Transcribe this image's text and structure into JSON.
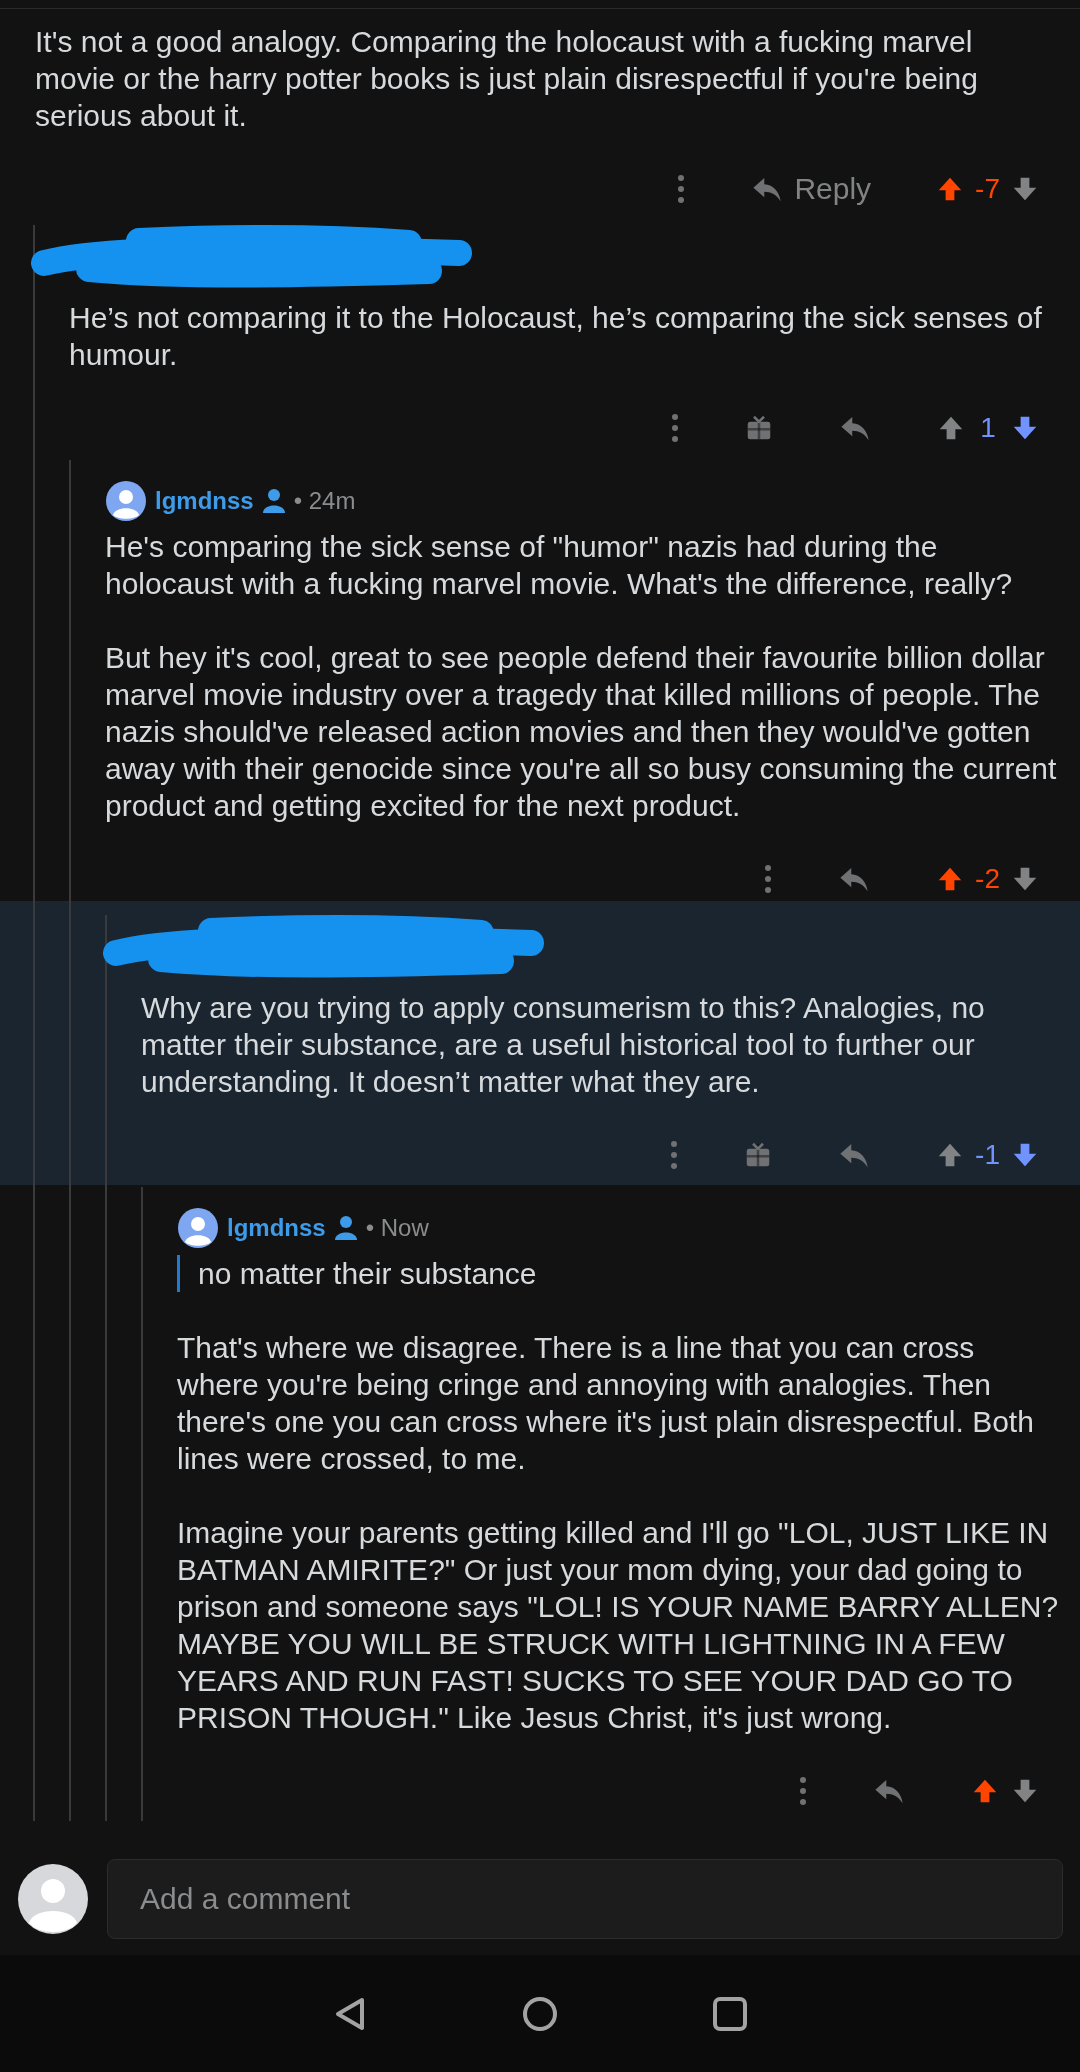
{
  "comments": [
    {
      "author_redacted": false,
      "highlighted": false,
      "body": [
        {
          "kind": "paragraph",
          "text": "It's not a good analogy. Comparing the holocaust with a fucking marvel movie or the harry potter books is just plain disrespectful if you're being serious about it."
        }
      ],
      "gift": false,
      "reply_label": "Reply",
      "upvoted": true,
      "downvoted": false,
      "score": "-7",
      "children": [
        {
          "author_redacted": true,
          "highlighted": false,
          "body": [
            {
              "kind": "paragraph",
              "text": "He’s not comparing it to the Holocaust, he’s comparing the sick senses of humour."
            }
          ],
          "gift": true,
          "upvoted": false,
          "downvoted": true,
          "score": "1",
          "children": [
            {
              "author_redacted": false,
              "highlighted": false,
              "author": {
                "name": "lgmdnss",
                "time": "• 24m"
              },
              "body": [
                {
                  "kind": "paragraph",
                  "text": "He's comparing the sick sense of \"humor\" nazis had during the holocaust with a fucking marvel movie. What's the difference, really?"
                },
                {
                  "kind": "paragraph",
                  "text": "But hey it's cool, great to see people defend their favourite billion dollar marvel movie industry over a tragedy that killed millions of people. The nazis should've released action movies and then they would've gotten away with their genocide since you're all so busy consuming the current product and getting excited for the next product."
                }
              ],
              "gift": false,
              "upvoted": true,
              "downvoted": false,
              "score": "-2",
              "children": [
                {
                  "author_redacted": true,
                  "highlighted": true,
                  "body": [
                    {
                      "kind": "paragraph",
                      "text": "Why are you trying to apply consumerism to this? Analogies, no matter their substance, are a useful historical tool to further our understanding. It doesn’t matter what they are."
                    }
                  ],
                  "gift": true,
                  "upvoted": false,
                  "downvoted": true,
                  "score": "-1",
                  "children": [
                    {
                      "author_redacted": false,
                      "highlighted": false,
                      "author": {
                        "name": "lgmdnss",
                        "time": "• Now"
                      },
                      "body": [
                        {
                          "kind": "quote",
                          "text": "no matter their substance"
                        },
                        {
                          "kind": "paragraph",
                          "text": "That's where we disagree. There is a line that you can cross where you're being cringe and annoying with analogies. Then there's one you can cross where it's just plain disrespectful. Both lines were crossed, to me."
                        },
                        {
                          "kind": "paragraph",
                          "text": "Imagine your parents getting killed and I'll go \"LOL, JUST LIKE IN BATMAN AMIRITE?\" Or just your mom dying, your dad going to prison and someone says \"LOL! IS YOUR NAME BARRY ALLEN? MAYBE YOU WILL BE STRUCK WITH LIGHTNING IN A FEW YEARS AND RUN FAST! SUCKS TO SEE YOUR DAD GO TO PRISON THOUGH.\" Like Jesus Christ, it's just wrong."
                        }
                      ],
                      "gift": false,
                      "upvoted": true,
                      "downvoted": false
                    }
                  ]
                }
              ]
            }
          ]
        }
      ]
    }
  ],
  "composer": {
    "placeholder": "Add a comment"
  }
}
